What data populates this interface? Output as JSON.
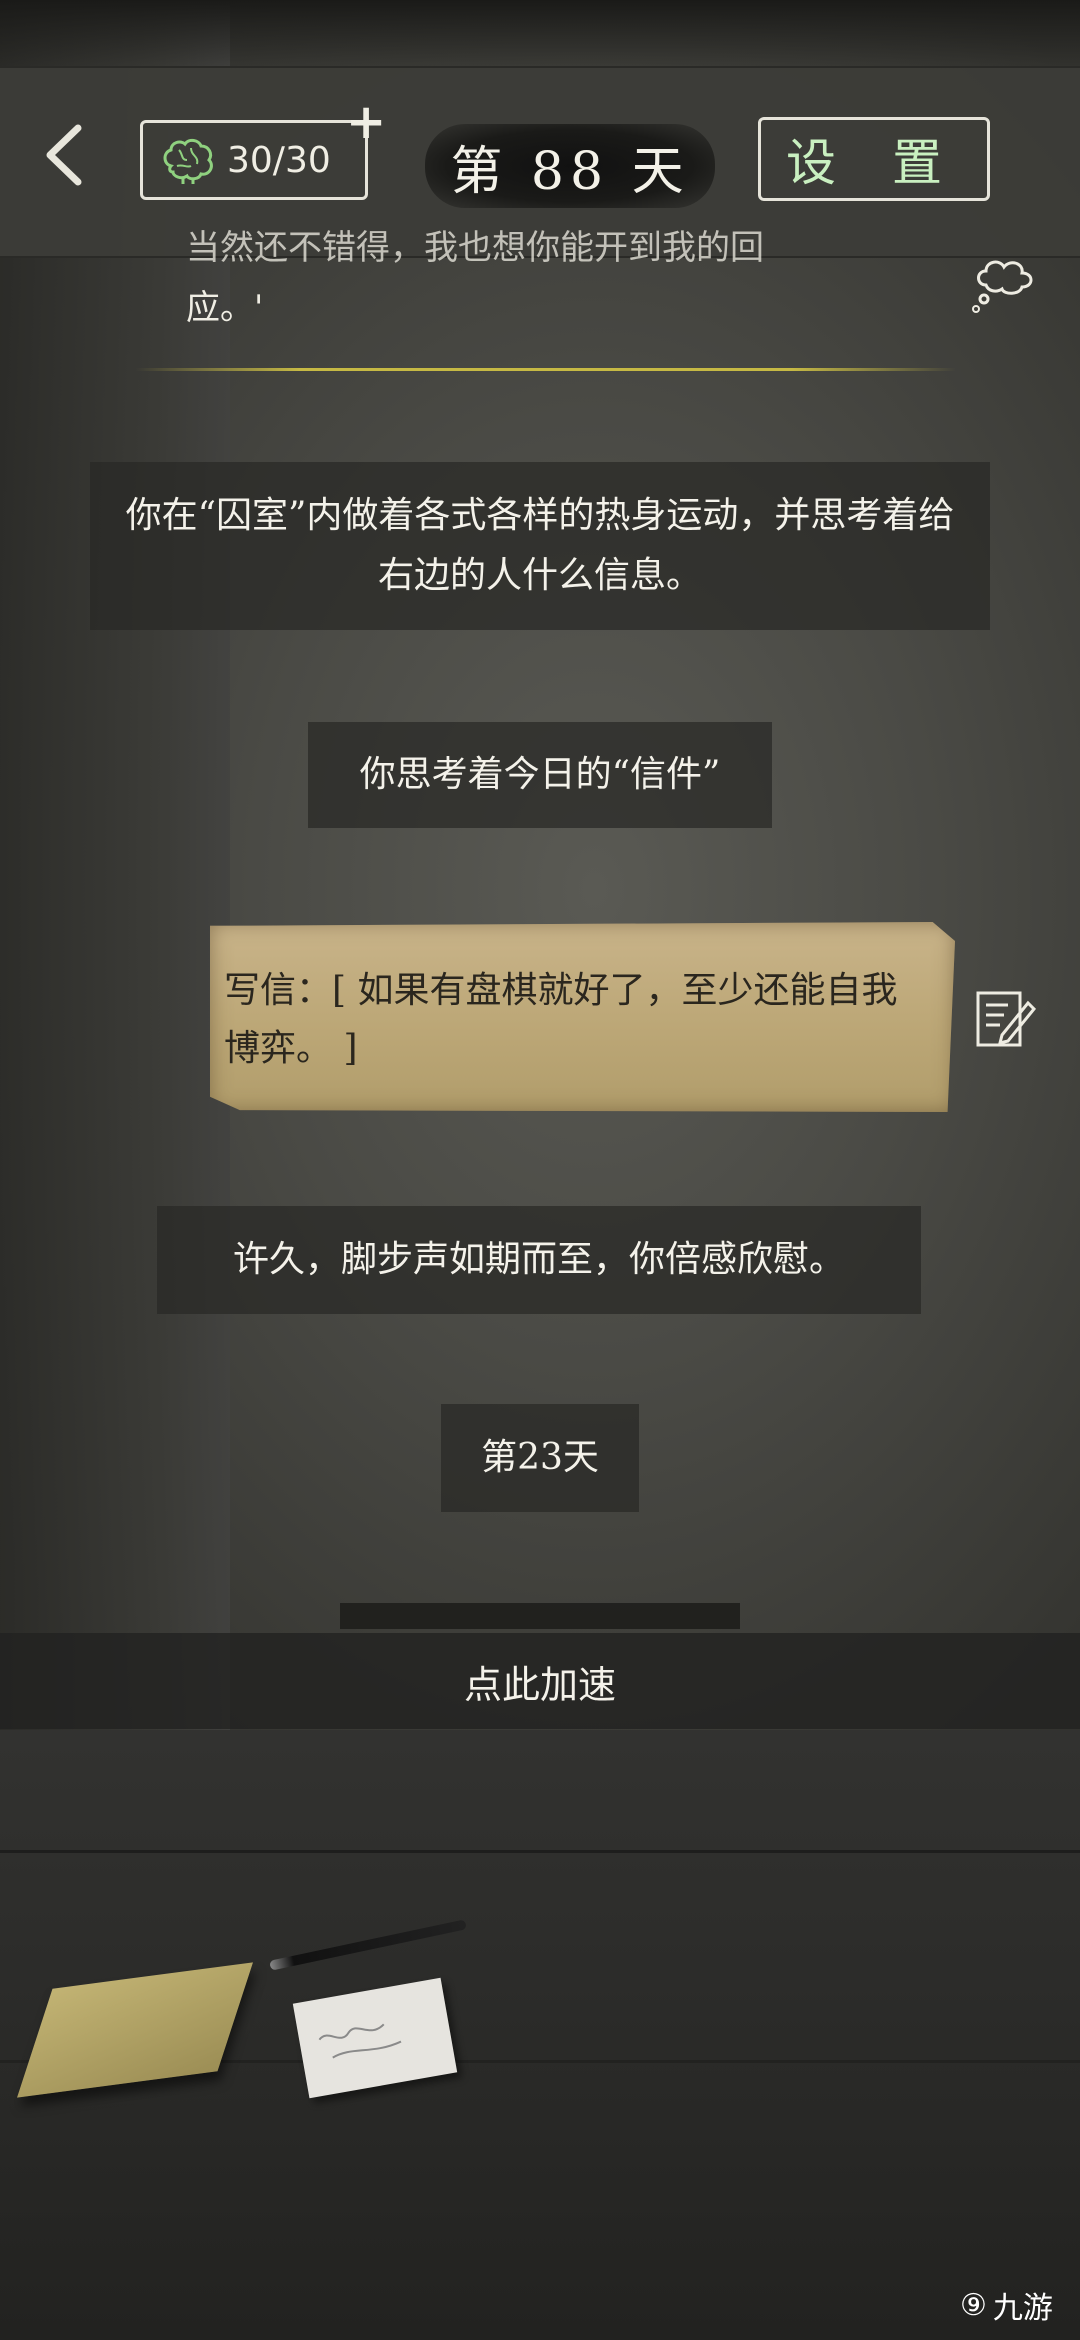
{
  "header": {
    "back_glyph": "<",
    "brain_count": "30/30",
    "plus_glyph": "+",
    "day_title": "第 88 天",
    "settings_label": "设 置"
  },
  "story": {
    "partial_top": "当然还不错得，我也想你能开到我的回",
    "partial_bottom": "应。'",
    "panel1": "你在“囚室”内做着各式各样的热身运动，并思考着给右边的人什么信息。",
    "panel2": "你思考着今日的“信件”",
    "letter": "写信：[ 如果有盘棋就好了，至少还能自我博弈。 ]",
    "panel3": "许久，脚步声如期而至，你倍感欣慰。",
    "panel4": "第23天"
  },
  "speed_button": "点此加速",
  "watermark": "九游",
  "icons": {
    "brain": "brain-icon",
    "thought": "thought-bubble-icon",
    "edit": "edit-letter-icon"
  },
  "colors": {
    "divider": "#c6b944",
    "settings_text": "#c9f0c0",
    "brain_stroke": "#8fd17f"
  }
}
